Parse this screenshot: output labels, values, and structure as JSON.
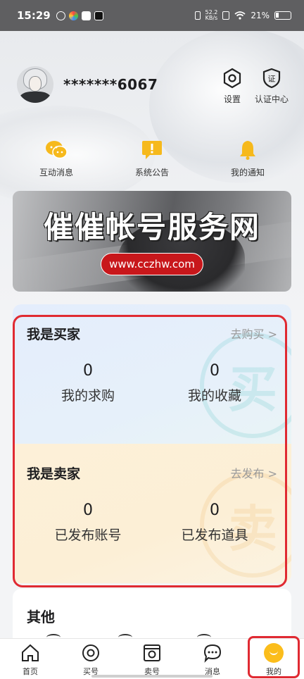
{
  "status_bar": {
    "time": "15:29",
    "net_speed_top": "52.2",
    "net_speed_bottom": "KB/s",
    "battery": "21%"
  },
  "profile": {
    "username": "*******6067"
  },
  "top_actions": {
    "settings_label": "设置",
    "certification_label": "认证中心",
    "certification_icon_text": "证"
  },
  "messages": {
    "interactive_label": "互动消息",
    "system_label": "系统公告",
    "notification_label": "我的通知"
  },
  "banner": {
    "title": "催催帐号服务网",
    "url": "www.cczhw.com"
  },
  "buyer_card": {
    "title": "我是买家",
    "link": "去购买 >",
    "watermark": "买",
    "stat1_value": "0",
    "stat1_label": "我的求购",
    "stat2_value": "0",
    "stat2_label": "我的收藏"
  },
  "seller_card": {
    "title": "我是卖家",
    "link": "去发布 >",
    "watermark": "卖",
    "stat1_value": "0",
    "stat1_label": "已发布账号",
    "stat2_value": "0",
    "stat2_label": "已发布道具"
  },
  "other": {
    "title": "其他"
  },
  "tabbar": {
    "home": "首页",
    "buy": "买号",
    "sell": "卖号",
    "messages": "消息",
    "mine": "我的"
  },
  "colors": {
    "accent_yellow": "#fbbd1b",
    "highlight_red": "#e02a32",
    "url_badge_red": "#c8171b"
  }
}
